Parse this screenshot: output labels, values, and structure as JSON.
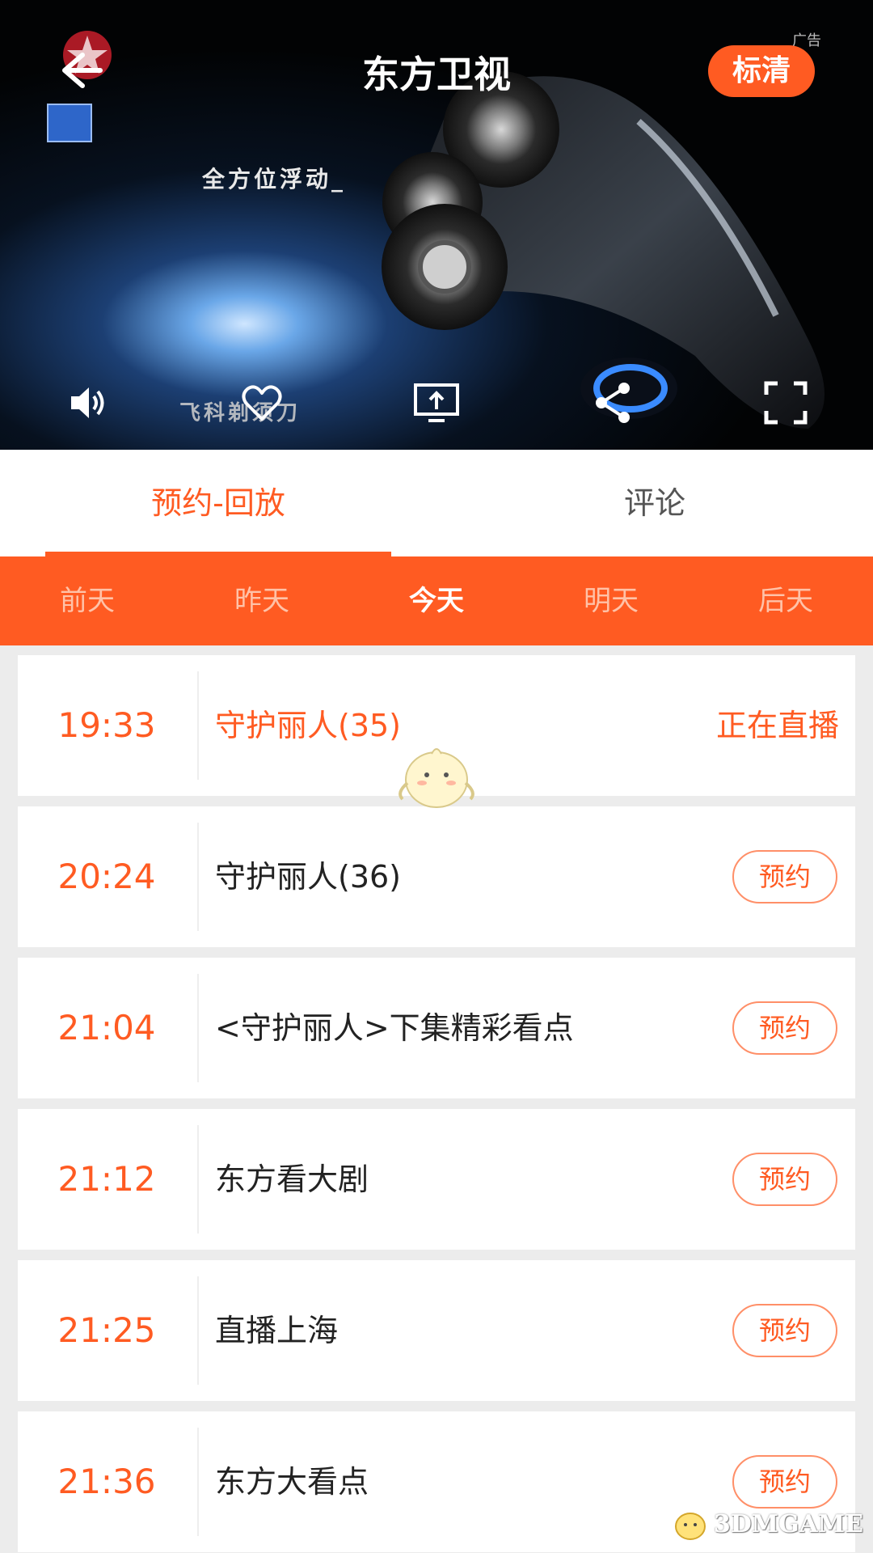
{
  "player": {
    "title": "东方卫视",
    "quality": "标清",
    "ad_label": "广告",
    "ad_caption_1": "全方位浮动_",
    "ad_caption_2": "飞科剃须刀",
    "controls": [
      "volume-icon",
      "heart-icon",
      "cast-icon",
      "share-icon",
      "fullscreen-icon"
    ]
  },
  "tabs": [
    {
      "label": "预约-回放",
      "active": true
    },
    {
      "label": "评论",
      "active": false
    }
  ],
  "days": [
    {
      "label": "前天",
      "selected": false
    },
    {
      "label": "昨天",
      "selected": false
    },
    {
      "label": "今天",
      "selected": true
    },
    {
      "label": "明天",
      "selected": false
    },
    {
      "label": "后天",
      "selected": false
    }
  ],
  "programs": [
    {
      "time": "19:33",
      "name": "守护丽人(35)",
      "status": "正在直播",
      "live": true
    },
    {
      "time": "20:24",
      "name": "守护丽人(36)",
      "action": "预约"
    },
    {
      "time": "21:04",
      "name": "<守护丽人>下集精彩看点",
      "action": "预约"
    },
    {
      "time": "21:12",
      "name": "东方看大剧",
      "action": "预约"
    },
    {
      "time": "21:25",
      "name": "直播上海",
      "action": "预约"
    },
    {
      "time": "21:36",
      "name": "东方大看点",
      "action": "预约"
    }
  ],
  "watermark": "3DMGAME",
  "colors": {
    "accent": "#ff5b22",
    "day_inactive": "#ffc2a8",
    "text_dark": "#222222"
  }
}
